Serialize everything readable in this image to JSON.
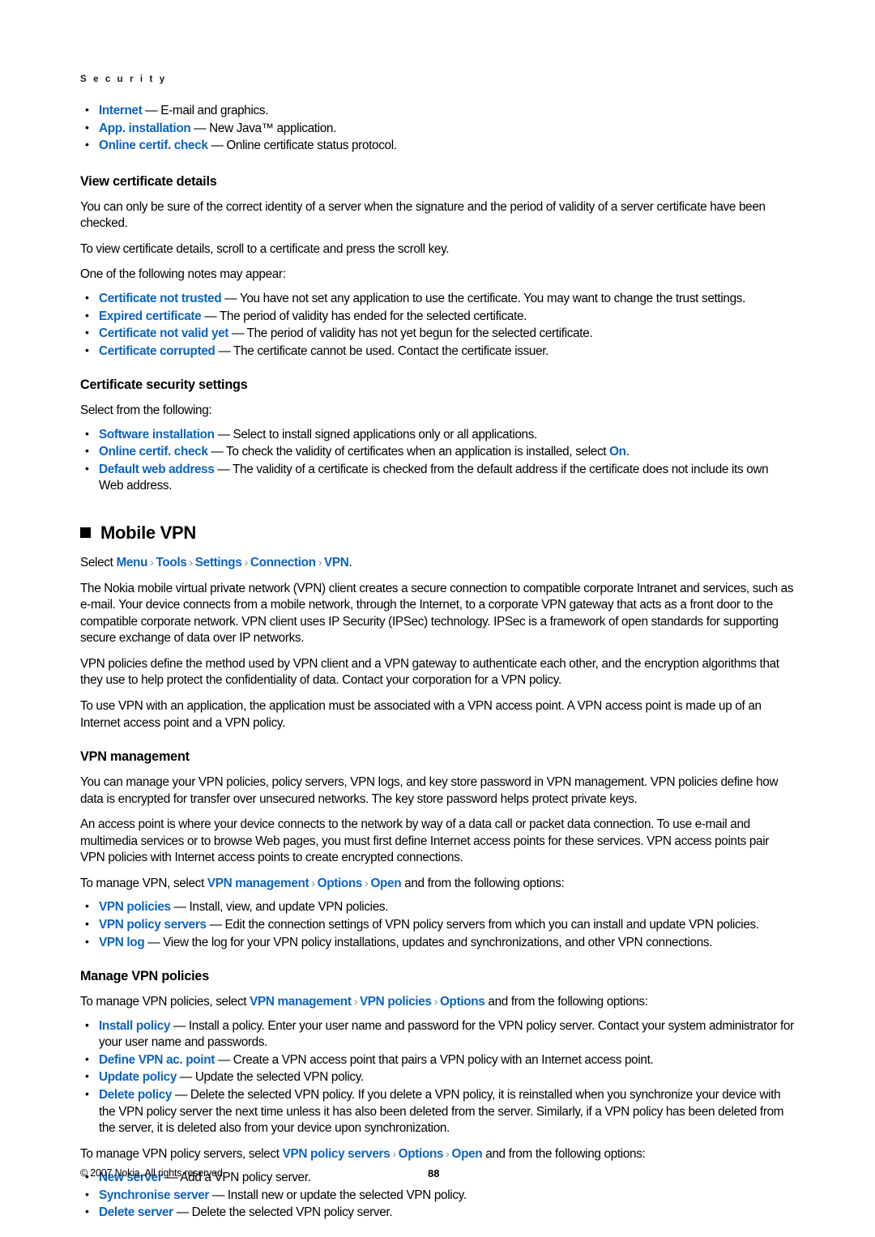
{
  "running_head": "S e c u r i t y",
  "intro_bullets": [
    {
      "term": "Internet",
      "rest": " — E-mail and graphics."
    },
    {
      "term": "App. installation",
      "rest": " — New Java™ application."
    },
    {
      "term": "Online certif. check",
      "rest": " — Online certificate status protocol."
    }
  ],
  "view_cert": {
    "heading": "View certificate details",
    "p1": "You can only be sure of the correct identity of a server when the signature and the period of validity of a server certificate have been checked.",
    "p2": "To view certificate details, scroll to a certificate and press the scroll key.",
    "p3": "One of the following notes may appear:",
    "bullets": [
      {
        "term": "Certificate not trusted",
        "rest": " — You have not set any application to use the certificate. You may want to change the trust settings."
      },
      {
        "term": "Expired certificate",
        "rest": " — The period of validity has ended for the selected certificate."
      },
      {
        "term": "Certificate not valid yet",
        "rest": " — The period of validity has not yet begun for the selected certificate."
      },
      {
        "term": "Certificate corrupted",
        "rest": "  — The certificate cannot be used. Contact the certificate issuer."
      }
    ]
  },
  "cert_security": {
    "heading": "Certificate security settings",
    "p1": "Select from the following:",
    "bullets": [
      {
        "term": "Software installation",
        "rest": " — Select to install signed applications only or all applications."
      },
      {
        "term": "Online certif. check",
        "rest": " — To check the validity of certificates when an application is installed, select ",
        "tail_kw": "On",
        "tail": "."
      },
      {
        "term": "Default web address",
        "rest": " — The validity of a certificate is checked from the default address if the certificate does not include its own Web address."
      }
    ]
  },
  "mobile_vpn": {
    "heading": "Mobile VPN",
    "bullet_icon": "black-square-bullet",
    "select_prefix": "Select ",
    "breadcrumb": [
      "Menu",
      "Tools",
      "Settings",
      "Connection",
      "VPN"
    ],
    "breadcrumb_separator": "›",
    "select_suffix": ".",
    "p1": "The Nokia mobile virtual private network (VPN) client creates a secure connection to compatible corporate Intranet and services, such as e-mail. Your device connects from a mobile network, through the Internet, to a corporate VPN gateway that acts as a front door to the compatible corporate network. VPN client uses IP Security (IPSec) technology. IPSec is a framework of open standards for supporting secure exchange of data over IP networks.",
    "p2": "VPN policies define the method used by VPN client and a VPN gateway to authenticate each other, and the encryption algorithms that they use to help protect the confidentiality of data. Contact your corporation for a VPN policy.",
    "p3": "To use VPN with an application, the application must be associated with a VPN access point. A VPN access point is made up of an Internet access point and a VPN policy."
  },
  "vpn_management": {
    "heading": "VPN management",
    "p1": "You can manage your VPN policies, policy servers, VPN logs, and key store password in VPN management. VPN policies define how data is encrypted for transfer over unsecured networks. The key store password helps protect private keys.",
    "p2": "An access point is where your device connects to the network by way of a data call or packet data connection. To use e-mail and multimedia services or to browse Web pages, you must first define Internet access points for these services. VPN access points pair VPN policies with Internet access points to create encrypted connections.",
    "lead_prefix": "To manage VPN, select ",
    "lead_path": [
      "VPN management",
      "Options",
      "Open"
    ],
    "lead_suffix": " and from the following options:",
    "bullets": [
      {
        "term": "VPN policies",
        "rest": " — Install, view, and update VPN policies."
      },
      {
        "term": "VPN policy servers",
        "rest": " — Edit the connection settings of VPN policy servers from which you can install and update VPN policies."
      },
      {
        "term": "VPN log",
        "rest": " — View the log for your VPN policy installations, updates and synchronizations, and other VPN connections."
      }
    ]
  },
  "manage_policies": {
    "heading": "Manage VPN policies",
    "lead_prefix": "To manage VPN policies, select ",
    "lead_path": [
      "VPN management",
      "VPN policies",
      "Options"
    ],
    "lead_suffix": " and from the following options:",
    "bullets": [
      {
        "term": "Install policy",
        "rest": " — Install a policy. Enter your user name and password for the VPN policy server. Contact your system administrator for your user name and passwords."
      },
      {
        "term": "Define VPN ac. point",
        "rest": " — Create a VPN access point that pairs a VPN policy with an Internet access point."
      },
      {
        "term": "Update policy",
        "rest": " — Update the selected VPN policy."
      },
      {
        "term": "Delete policy",
        "rest": " — Delete the selected VPN policy. If you delete a VPN policy, it is reinstalled when you synchronize your device with the VPN policy server the next time unless it has also been deleted from the server. Similarly, if a VPN policy has been deleted from the server, it is deleted also from your device upon synchronization."
      }
    ],
    "servers_prefix": "To manage VPN policy servers, select ",
    "servers_path": [
      "VPN policy servers",
      "Options",
      "Open"
    ],
    "servers_suffix": " and from the following options:",
    "server_bullets": [
      {
        "term": "New server",
        "rest": " — Add a VPN policy server."
      },
      {
        "term": "Synchronise server",
        "rest": " — Install new or update the selected VPN policy."
      },
      {
        "term": "Delete server",
        "rest": " — Delete the selected VPN policy server."
      }
    ]
  },
  "footer": {
    "copyright": "© 2007 Nokia. All rights reserved.",
    "page_number": "88"
  },
  "colors": {
    "keyword_blue": "#0d64bd",
    "chevron_gray": "#8a8a8a",
    "text_black": "#000000"
  }
}
